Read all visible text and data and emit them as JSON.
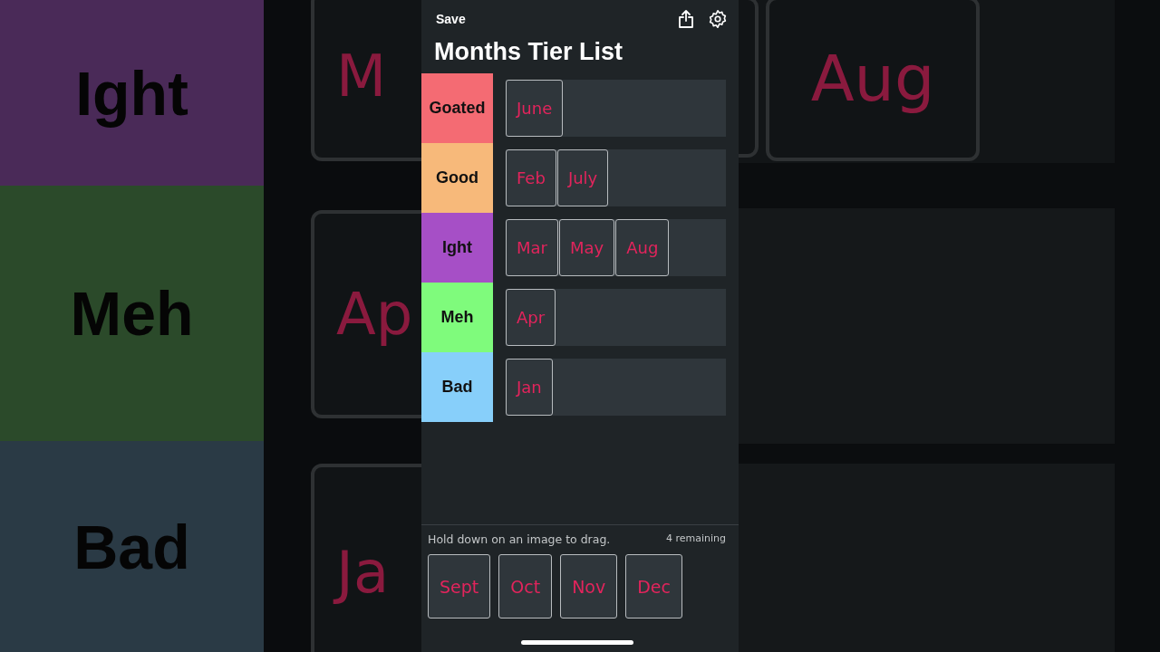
{
  "backdrop": {
    "tiers": [
      {
        "label": "Ight",
        "color": "#4a2a58"
      },
      {
        "label": "Meh",
        "color": "#2b4a2a"
      },
      {
        "label": "Bad",
        "color": "#2a3a45"
      }
    ],
    "left_tiles": [
      "M",
      "Ap",
      "Ja"
    ],
    "right_tiles": [
      "Aug"
    ]
  },
  "top_bar": {
    "save": "Save"
  },
  "title": "Months Tier List",
  "tiers": [
    {
      "label": "Goated",
      "color": "#f46b73",
      "items": [
        "June"
      ]
    },
    {
      "label": "Good",
      "color": "#f7b97a",
      "items": [
        "Feb",
        "July"
      ]
    },
    {
      "label": "Ight",
      "color": "#a64fc6",
      "items": [
        "Mar",
        "May",
        "Aug"
      ]
    },
    {
      "label": "Meh",
      "color": "#7ffb7c",
      "items": [
        "Apr"
      ]
    },
    {
      "label": "Bad",
      "color": "#87cffa",
      "items": [
        "Jan"
      ]
    }
  ],
  "pool": {
    "hint": "Hold down on an image to drag.",
    "count": "4 remaining",
    "items": [
      "Sept",
      "Oct",
      "Nov",
      "Dec"
    ]
  }
}
